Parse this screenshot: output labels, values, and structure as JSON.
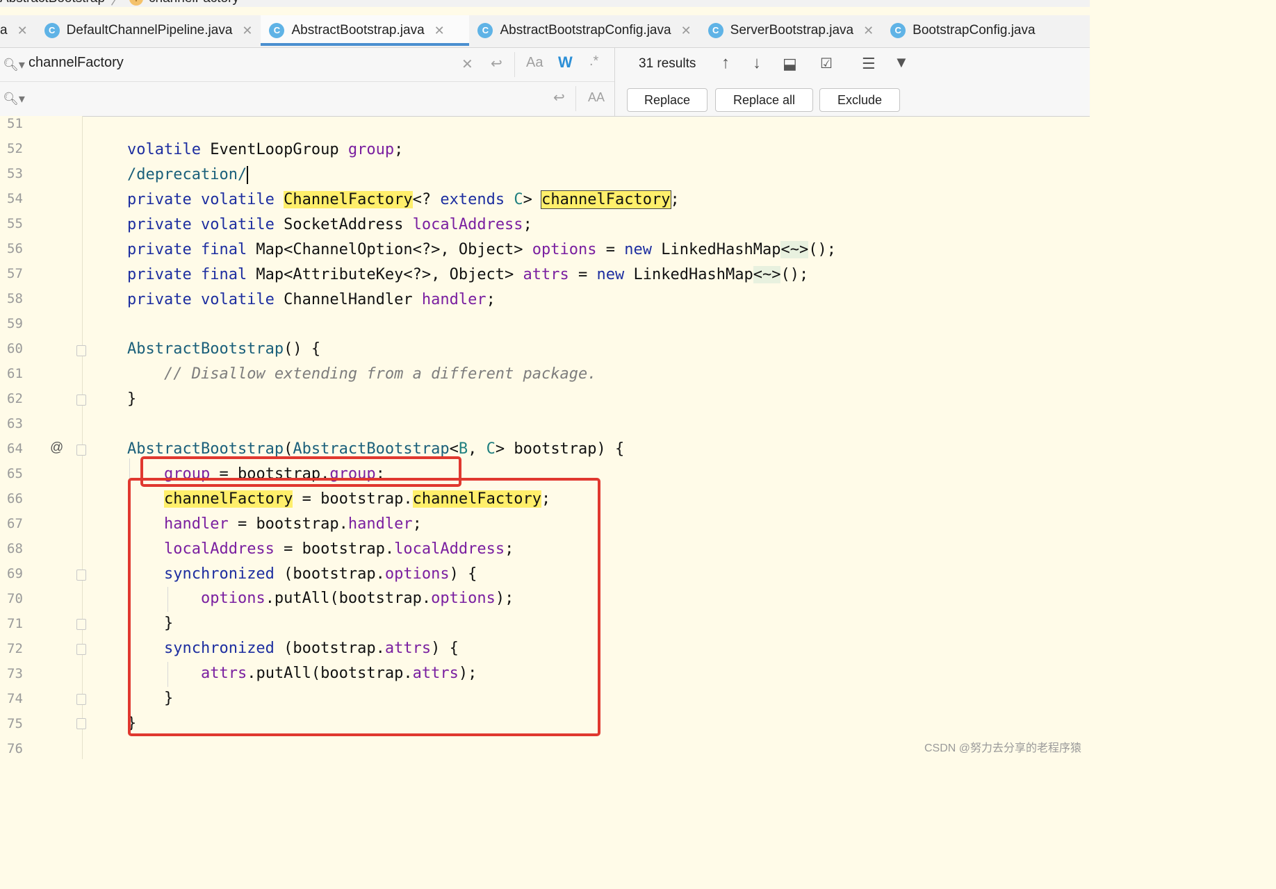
{
  "breadcrumb": {
    "item1": "AbstractBootstrap",
    "item2_badge": "f",
    "item2": "channelFactory"
  },
  "tabs": [
    {
      "label": "a",
      "icon": ""
    },
    {
      "label": "DefaultChannelPipeline.java",
      "icon": "C"
    },
    {
      "label": "AbstractBootstrap.java",
      "icon": "C",
      "active": true
    },
    {
      "label": "AbstractBootstrapConfig.java",
      "icon": "C"
    },
    {
      "label": "ServerBootstrap.java",
      "icon": "C"
    },
    {
      "label": "BootstrapConfig.java",
      "icon": "C"
    }
  ],
  "search": {
    "query": "channelFactory",
    "results": "31 results",
    "case_label": "Aa",
    "word_label": "W",
    "regex_label": ".*",
    "preserve_case_label": "AA",
    "replace_button": "Replace",
    "replace_all_button": "Replace all",
    "exclude_button": "Exclude"
  },
  "editor": {
    "line_numbers": [
      "51",
      "52",
      "53",
      "54",
      "55",
      "56",
      "57",
      "58",
      "59",
      "60",
      "61",
      "62",
      "63",
      "64",
      "65",
      "66",
      "67",
      "68",
      "69",
      "70",
      "71",
      "72",
      "73",
      "74",
      "75",
      "76"
    ],
    "gutter_marker": "@"
  },
  "watermark": "CSDN @努力去分享的老程序猿",
  "colors": {
    "highlight": "#ffef6b",
    "redbox": "#e0382f",
    "tab_active": "#4a8fcf",
    "editor_bg": "#fffbe8"
  }
}
